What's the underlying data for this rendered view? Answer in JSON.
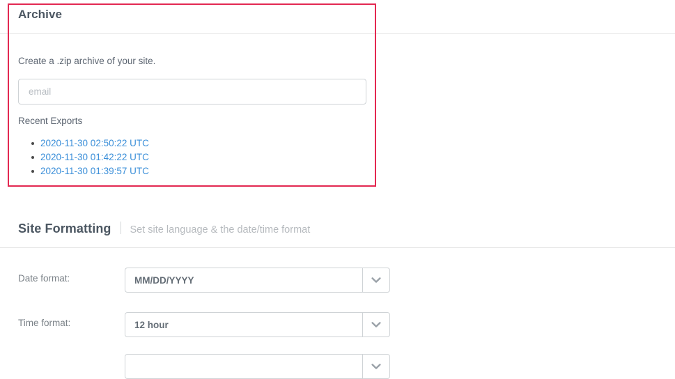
{
  "colors": {
    "highlight_border": "#e32851",
    "link": "#3b8fd9",
    "heading": "#4c5762",
    "body_text": "#5b6470",
    "muted_text": "#b6babe",
    "border": "#cfd3d6"
  },
  "archive": {
    "title": "Archive",
    "description": "Create a .zip archive of your site.",
    "email_field": {
      "placeholder": "email",
      "value": ""
    },
    "recent_exports_label": "Recent Exports",
    "recent_exports": [
      "2020-11-30 02:50:22 UTC",
      "2020-11-30 01:42:22 UTC",
      "2020-11-30 01:39:57 UTC"
    ]
  },
  "site_formatting": {
    "title": "Site Formatting",
    "subtitle": "Set site language & the date/time format",
    "fields": [
      {
        "label": "Date format:",
        "value": "MM/DD/YYYY",
        "icon": "chevron-down-icon"
      },
      {
        "label": "Time format:",
        "value": "12 hour",
        "icon": "chevron-down-icon"
      }
    ]
  }
}
